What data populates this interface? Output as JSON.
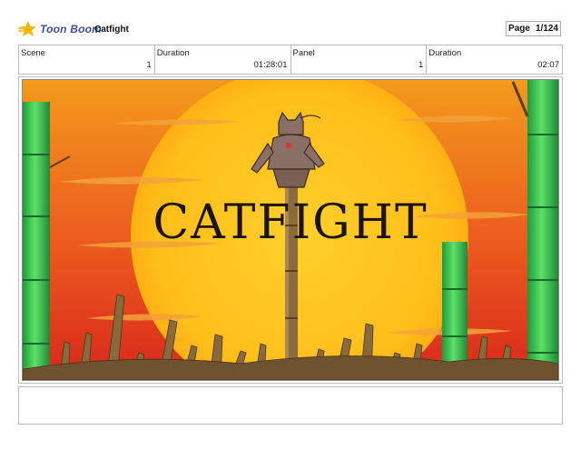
{
  "header": {
    "brand": "Toon Boom",
    "title": "Catfight",
    "page_label": "Page",
    "page_number": "1/124"
  },
  "info": {
    "scene_label": "Scene",
    "scene_value": "1",
    "duration1_label": "Duration",
    "duration1_value": "01:28:01",
    "panel_label": "Panel",
    "panel_value": "1",
    "duration2_label": "Duration",
    "duration2_value": "02:07"
  },
  "artwork": {
    "title_text": "CATFIGHT"
  },
  "caption": {
    "text": ""
  },
  "colors": {
    "sky_top": "#f07a14",
    "sky_bottom": "#e23a1e",
    "sun": "#ffc21a",
    "bamboo": "#3cc24a",
    "stalks": "#8a6a3a",
    "brand_blue": "#3b4fa8",
    "logo_yellow": "#f7b500"
  }
}
